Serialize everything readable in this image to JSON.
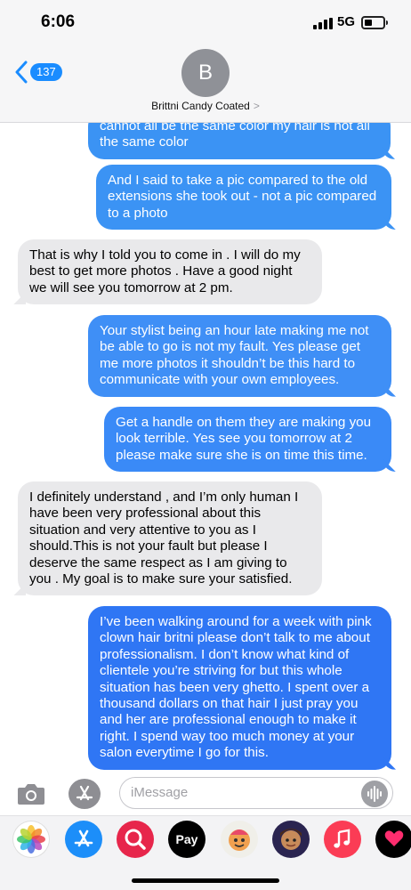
{
  "status_bar": {
    "time": "6:06",
    "network": "5G"
  },
  "header": {
    "back_count": "137",
    "avatar_initial": "B",
    "contact_name": "Brittni Candy Coated",
    "contact_chevron": ">"
  },
  "messages": [
    {
      "direction": "sent",
      "text": "cannot all be the same color my hair is not all the same color"
    },
    {
      "direction": "sent",
      "text": "And I said to take a pic compared to the old extensions she took out - not a pic compared to a photo"
    },
    {
      "direction": "received",
      "text": "That is why I told you to come in . I will do my best to get more photos . Have a good night we will see you tomorrow at 2 pm."
    },
    {
      "direction": "sent",
      "text": "Your stylist being an hour late making me not be able to go is not my fault. Yes please get me more photos it shouldn’t be this hard to communicate with your own employees."
    },
    {
      "direction": "sent",
      "text": "Get a handle on them they are making you look terrible. Yes see you tomorrow at 2 please make sure she is on time this time."
    },
    {
      "direction": "received",
      "text": "I definitely understand , and I’m only human I have been very professional about this situation and very attentive to you as I should.This is not your fault but please I deserve the same respect as I am giving to you . My goal is to make sure your satisfied."
    },
    {
      "direction": "sent",
      "text": "I’ve been walking around for a week with pink clown hair britni please don’t talk to me about professionalism. I don’t know what kind of clientele you’re striving for but this whole situation has been very ghetto. I spent over a thousand dollars on that hair I just pray you and her are professional enough to make it right. I spend way too much money at your salon everytime I go for this."
    }
  ],
  "input_bar": {
    "placeholder": "iMessage",
    "camera_icon": "camera-icon",
    "apps_icon": "app-store-icon",
    "audio_icon": "waveform-icon"
  },
  "app_drawer": {
    "apps": [
      {
        "name": "photos-icon"
      },
      {
        "name": "app-store-icon"
      },
      {
        "name": "images-search-icon"
      },
      {
        "name": "apple-pay-icon",
        "label": "Pay"
      },
      {
        "name": "memoji-stickers-icon"
      },
      {
        "name": "memoji-icon"
      },
      {
        "name": "music-icon"
      },
      {
        "name": "digital-touch-icon"
      }
    ]
  },
  "colors": {
    "sent_bubble": "#3b93f4",
    "received_bubble": "#e9e9eb",
    "accent": "#1a8cff"
  }
}
